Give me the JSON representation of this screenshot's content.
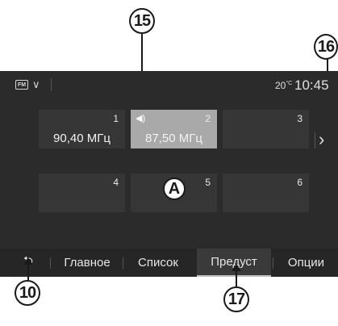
{
  "callouts": {
    "c15": "15",
    "c16": "16",
    "c10": "10",
    "c17": "17",
    "marker": "A"
  },
  "status": {
    "source_badge": "FM",
    "source_icon": "fm-radio-icon",
    "temp_value": "20",
    "temp_unit": "°C",
    "clock": "10:45"
  },
  "presets": [
    {
      "num": "1",
      "freq": "90,40 МГц",
      "active": false
    },
    {
      "num": "2",
      "freq": "87,50 МГц",
      "active": true
    },
    {
      "num": "3",
      "freq": "",
      "active": false
    },
    {
      "num": "4",
      "freq": "",
      "active": false
    },
    {
      "num": "5",
      "freq": "",
      "active": false
    },
    {
      "num": "6",
      "freq": "",
      "active": false
    }
  ],
  "tabs": {
    "back": "back-icon",
    "main": "Главное",
    "list": "Список",
    "presets": "Предуст",
    "options": "Опции"
  },
  "colors": {
    "screen_bg": "#2b2b2b",
    "tile": "#363636",
    "tile_active": "#a9a9a9"
  }
}
